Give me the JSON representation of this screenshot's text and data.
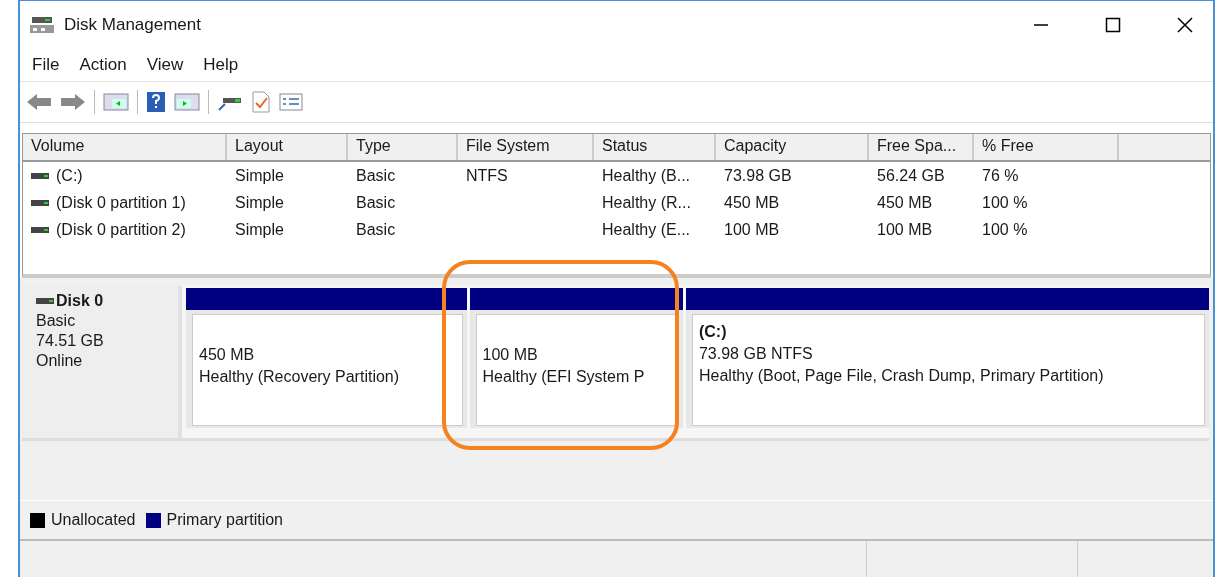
{
  "window": {
    "title": "Disk Management"
  },
  "menu": [
    {
      "label": "File"
    },
    {
      "label": "Action"
    },
    {
      "label": "View"
    },
    {
      "label": "Help"
    }
  ],
  "volume_list": {
    "columns": [
      "Volume",
      "Layout",
      "Type",
      "File System",
      "Status",
      "Capacity",
      "Free Spa...",
      "% Free"
    ],
    "rows": [
      {
        "cells": [
          "(C:)",
          "Simple",
          "Basic",
          "NTFS",
          "Healthy (B...",
          "73.98 GB",
          "56.24 GB",
          "76 %"
        ]
      },
      {
        "cells": [
          "(Disk 0 partition 1)",
          "Simple",
          "Basic",
          "",
          "Healthy (R...",
          "450 MB",
          "450 MB",
          "100 %"
        ]
      },
      {
        "cells": [
          "(Disk 0 partition 2)",
          "Simple",
          "Basic",
          "",
          "Healthy (E...",
          "100 MB",
          "100 MB",
          "100 %"
        ]
      }
    ]
  },
  "disks": [
    {
      "name": "Disk 0",
      "type": "Basic",
      "size": "74.51 GB",
      "state": "Online",
      "partitions": [
        {
          "kind": "primary",
          "lines": [
            "450 MB",
            "Healthy (Recovery Partition)"
          ],
          "highlighted": false
        },
        {
          "kind": "primary",
          "lines": [
            "100 MB",
            "Healthy (EFI System P"
          ],
          "highlighted": true
        },
        {
          "kind": "primary",
          "title": "(C:)",
          "lines": [
            "73.98 GB NTFS",
            "Healthy (Boot, Page File, Crash Dump, Primary Partition)"
          ],
          "highlighted": false
        }
      ]
    }
  ],
  "legend": [
    {
      "label": "Unallocated",
      "color": "#000000"
    },
    {
      "label": "Primary partition",
      "color": "#000080"
    }
  ]
}
